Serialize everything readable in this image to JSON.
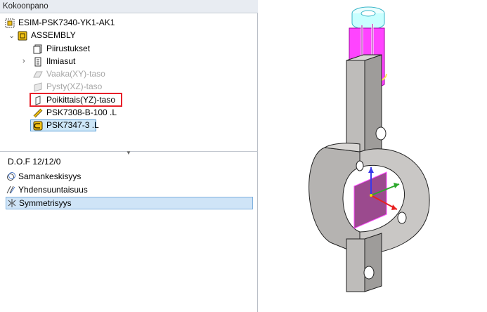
{
  "panel": {
    "title": "Kokoonpano"
  },
  "tree": {
    "root": "ESIM-PSK7340-YK1-AK1",
    "assembly": "ASSEMBLY",
    "items": [
      {
        "label": "Piirustukset",
        "state": "normal"
      },
      {
        "label": "Ilmiasut",
        "state": "normal"
      },
      {
        "label": "Vaaka(XY)-taso",
        "state": "greyed"
      },
      {
        "label": "Pysty(XZ)-taso",
        "state": "greyed"
      },
      {
        "label": "Poikittais(YZ)-taso",
        "state": "highlighted"
      },
      {
        "label": "PSK7308-B-100 .L",
        "state": "normal"
      },
      {
        "label": "PSK7347-3 .L",
        "state": "active"
      }
    ]
  },
  "constraints": {
    "dof": "D.O.F  12/12/0",
    "items": [
      {
        "label": "Samankeskisyys",
        "icon": "concentric-icon"
      },
      {
        "label": "Yhdensuuntaisuus",
        "icon": "parallel-icon"
      },
      {
        "label": "Symmetrisyys",
        "icon": "symmetry-icon",
        "selected": true
      }
    ]
  },
  "colors": {
    "highlight_border": "#e8202a",
    "selection": "#cfe4f7",
    "part_magenta": "#ff1dff",
    "part_cyan": "#66ffff",
    "part_body": "#c8c6c4"
  }
}
